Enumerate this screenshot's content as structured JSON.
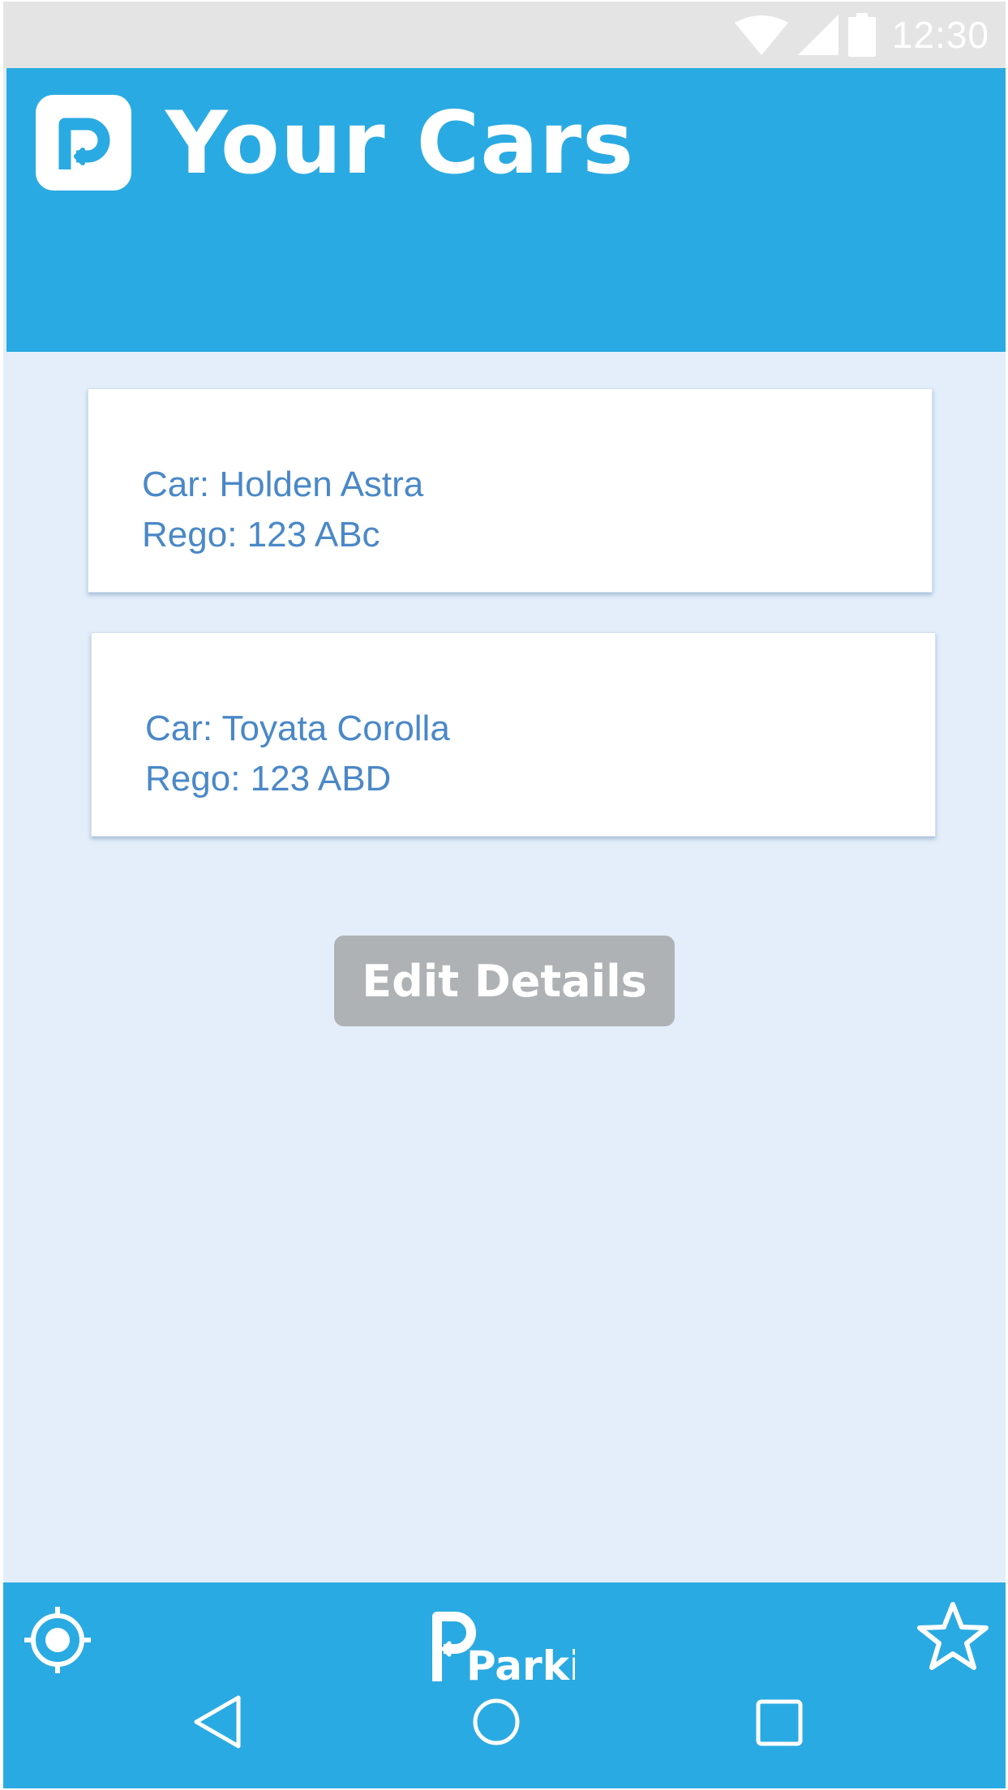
{
  "status_bar": {
    "time": "12:30",
    "icons": [
      "wifi-icon",
      "signal-icon",
      "battery-icon"
    ]
  },
  "header": {
    "title": "Your Cars",
    "logo_icon": "parking-logo-icon"
  },
  "cars": [
    {
      "car_line": "Car: Holden Astra",
      "rego_line": "Rego: 123 ABc"
    },
    {
      "car_line": "Car: Toyata Corolla",
      "rego_line": "Rego: 123 ABD"
    }
  ],
  "actions": {
    "edit_label": "Edit Details"
  },
  "bottom_nav": {
    "left_icon": "location-target-icon",
    "brand_logo": "parkit-logo",
    "brand_text": "Parkit.",
    "right_icon": "star-icon"
  },
  "system_nav": {
    "icons": [
      "back-icon",
      "home-icon",
      "recents-icon"
    ]
  },
  "colors": {
    "accent": "#2aaae2",
    "background": "#e3eefa",
    "card_text": "#4a88c7",
    "button": "#afb2b5"
  }
}
